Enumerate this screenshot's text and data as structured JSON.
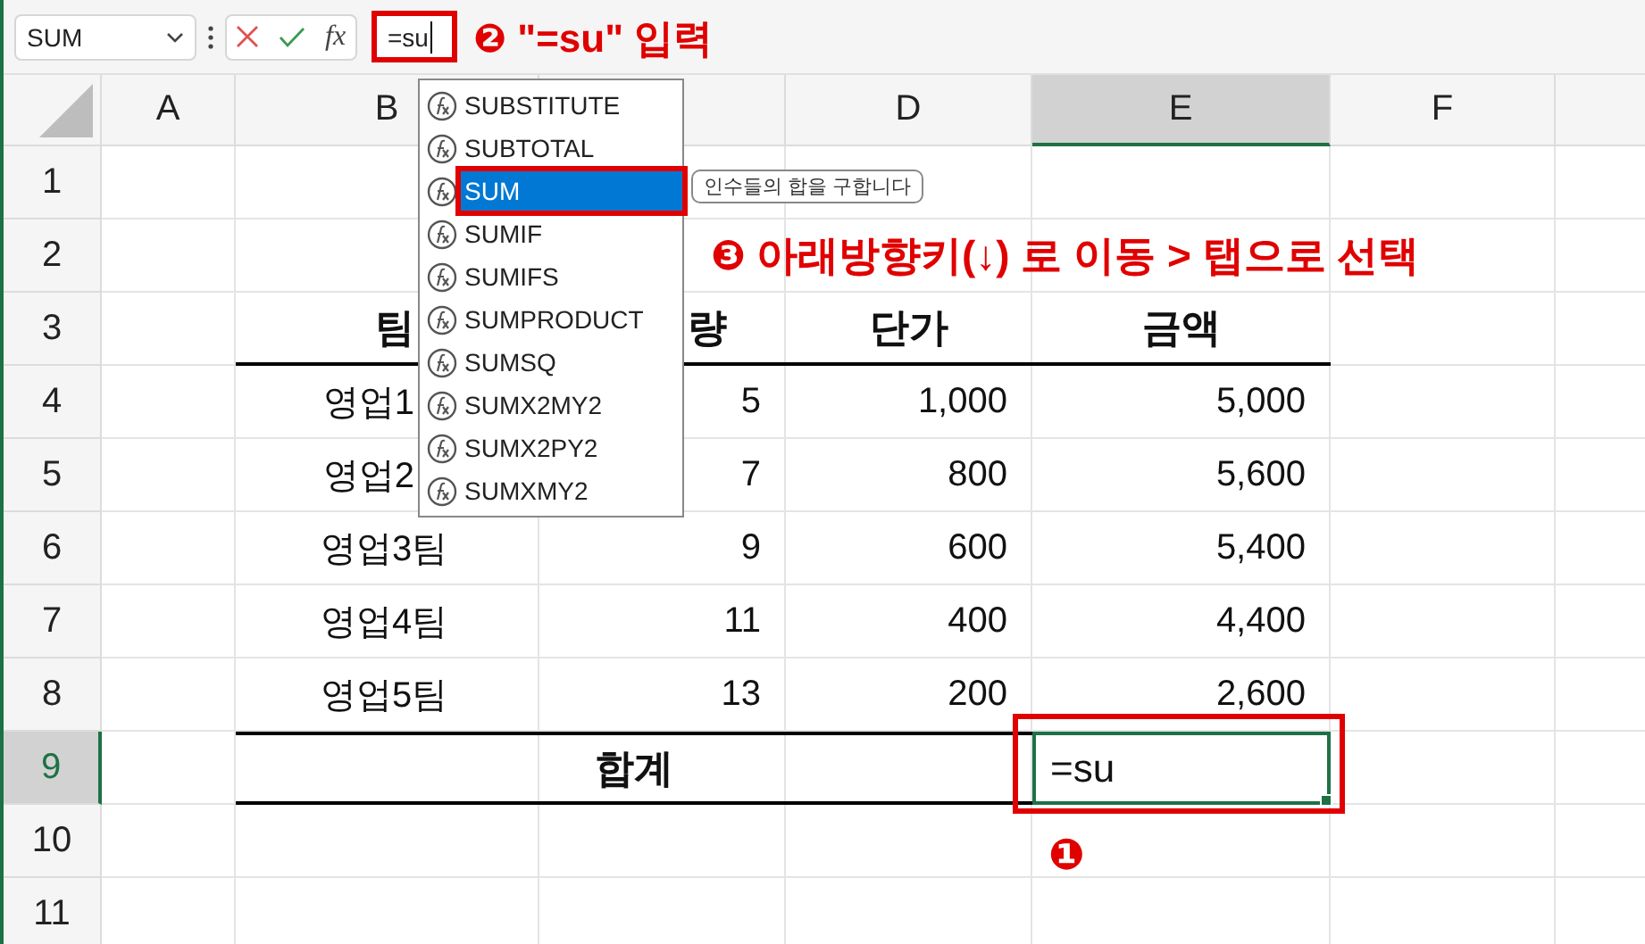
{
  "name_box": {
    "value": "SUM"
  },
  "formula_bar": {
    "fx_label": "fx",
    "input": "=su"
  },
  "columns": [
    {
      "label": "A",
      "selected": false
    },
    {
      "label": "B",
      "selected": false
    },
    {
      "selected": false
    },
    {
      "label": "D",
      "selected": false
    },
    {
      "label": "E",
      "selected": true
    },
    {
      "label": "F",
      "selected": false
    },
    {
      "selected": false
    }
  ],
  "rows": [
    {
      "header": "1",
      "kind": "blank",
      "selected": false,
      "cells": []
    },
    {
      "header": "2",
      "kind": "blank",
      "selected": false,
      "cells": []
    },
    {
      "header": "3",
      "kind": "header",
      "selected": false,
      "cells": [
        null,
        {
          "text": "팀",
          "kind": "partial_end"
        },
        {
          "text": "량",
          "kind": "partial_start"
        },
        "단가",
        "금액"
      ]
    },
    {
      "header": "4",
      "kind": "data",
      "selected": false,
      "cells": [
        null,
        {
          "text": "영업1",
          "kind": "partial_end"
        },
        "5",
        "1,000",
        "5,000"
      ]
    },
    {
      "header": "5",
      "kind": "data",
      "selected": false,
      "cells": [
        null,
        {
          "text": "영업2",
          "kind": "partial_end"
        },
        "7",
        "800",
        "5,600"
      ]
    },
    {
      "header": "6",
      "kind": "data",
      "selected": false,
      "cells": [
        null,
        "영업3팀",
        "9",
        "600",
        "5,400"
      ]
    },
    {
      "header": "7",
      "kind": "data",
      "selected": false,
      "cells": [
        null,
        "영업4팀",
        "11",
        "400",
        "4,400"
      ]
    },
    {
      "header": "8",
      "kind": "data",
      "selected": false,
      "cells": [
        null,
        "영업5팀",
        "13",
        "200",
        "2,600"
      ]
    },
    {
      "header": "9",
      "kind": "total",
      "selected": true,
      "label": "합계",
      "active_cell": "=su"
    },
    {
      "header": "10",
      "kind": "blank",
      "selected": false,
      "cells": []
    },
    {
      "header": "11",
      "kind": "blank",
      "selected": false,
      "cells": []
    }
  ],
  "autocomplete": {
    "items": [
      {
        "label": "SUBSTITUTE",
        "selected": false
      },
      {
        "label": "SUBTOTAL",
        "selected": false
      },
      {
        "label": "SUM",
        "selected": true
      },
      {
        "label": "SUMIF",
        "selected": false
      },
      {
        "label": "SUMIFS",
        "selected": false
      },
      {
        "label": "SUMPRODUCT",
        "selected": false
      },
      {
        "label": "SUMSQ",
        "selected": false
      },
      {
        "label": "SUMX2MY2",
        "selected": false
      },
      {
        "label": "SUMX2PY2",
        "selected": false
      },
      {
        "label": "SUMXMY2",
        "selected": false
      }
    ],
    "tooltip": "인수들의 합을 구합니다"
  },
  "annotations": [
    {
      "badge": "❷",
      "text": "\"=su\" 입력"
    },
    {
      "badge": "❸",
      "text": "아래방향키(↓) 로 이동 > 탭으로 선택"
    },
    {
      "badge": "❶"
    }
  ]
}
